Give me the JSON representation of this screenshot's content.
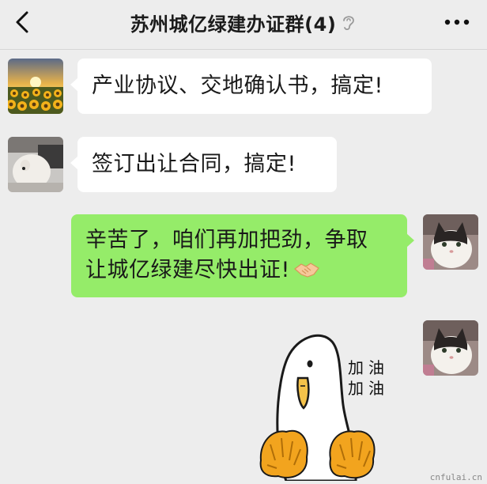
{
  "header": {
    "title": "苏州城亿绿建办证群(4)",
    "back_icon": "chevron-left-icon",
    "mute_icon": "ear-icon",
    "more_icon": "more-dots-icon"
  },
  "messages": [
    {
      "sender_avatar": "sunflower-field-avatar",
      "direction": "incoming",
      "text": "产业协议、交地确认书，搞定!"
    },
    {
      "sender_avatar": "white-pet-avatar",
      "direction": "incoming",
      "text": "签订出让合同，搞定!"
    },
    {
      "sender_avatar": "cat-avatar",
      "direction": "outgoing",
      "line1": "辛苦了，咱们再加把劲，争取",
      "line2": "让城亿绿建尽快出证!",
      "emoji": "handshake-emoji"
    },
    {
      "sender_avatar": "cat-avatar",
      "direction": "outgoing",
      "type": "sticker",
      "sticker_line1": "加油",
      "sticker_line2": "加油"
    }
  ],
  "watermark": "cnfulai.cn",
  "colors": {
    "background": "#ededed",
    "incoming_bubble": "#ffffff",
    "outgoing_bubble": "#95ec69"
  }
}
